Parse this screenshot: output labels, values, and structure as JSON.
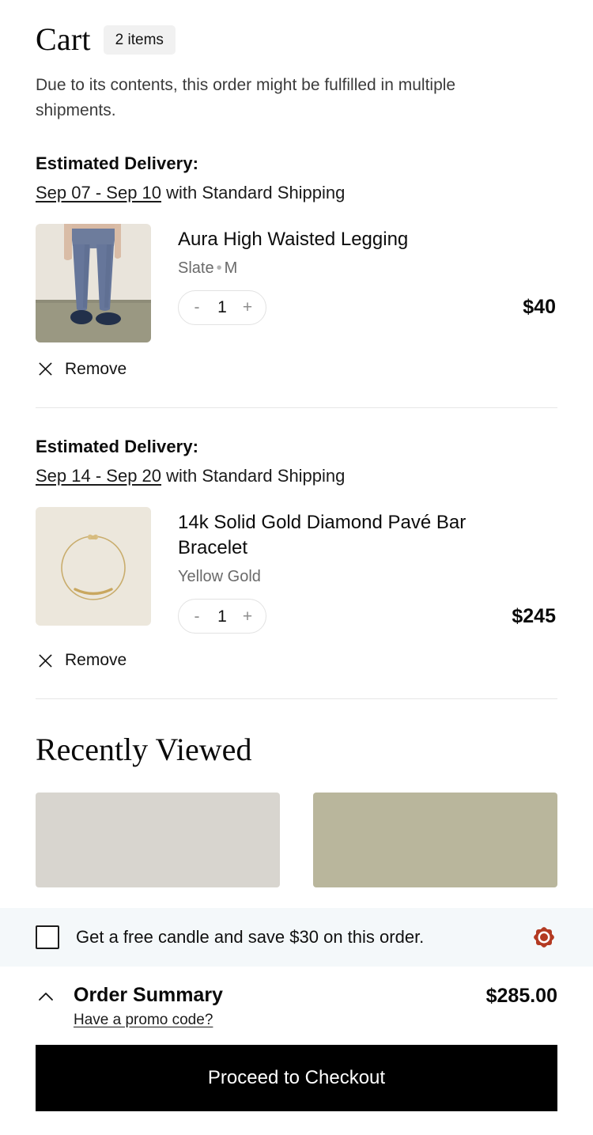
{
  "header": {
    "title": "Cart",
    "items_badge": "2 items",
    "fulfilment_note": "Due to its contents, this order might be fulfilled in multiple shipments."
  },
  "shipments": [
    {
      "delivery_label": "Estimated Delivery:",
      "delivery_dates": "Sep 07 - Sep 10",
      "delivery_method": " with Standard Shipping",
      "product": {
        "name": "Aura High Waisted Legging",
        "variant_color": "Slate",
        "variant_separator": "•",
        "variant_size": "M",
        "quantity": "1",
        "decrement_label": "-",
        "increment_label": "+",
        "price": "$40",
        "remove_label": "Remove",
        "image_alt": "slate-blue-leggings"
      }
    },
    {
      "delivery_label": "Estimated Delivery:",
      "delivery_dates": "Sep 14 - Sep 20",
      "delivery_method": " with Standard Shipping",
      "product": {
        "name": "14k Solid Gold Diamond Pavé Bar Bracelet",
        "variant_color": "Yellow Gold",
        "variant_separator": "",
        "variant_size": "",
        "quantity": "1",
        "decrement_label": "-",
        "increment_label": "+",
        "price": "$245",
        "remove_label": "Remove",
        "image_alt": "gold-bar-bracelet"
      }
    }
  ],
  "recently_viewed": {
    "title": "Recently Viewed",
    "cards": [
      {
        "swatch": "#d8d5cf"
      },
      {
        "swatch": "#b9b69c"
      }
    ]
  },
  "offer": {
    "text": "Get a free candle and save $30 on this order.",
    "checked": false,
    "badge_icon": "rosette-icon",
    "badge_color": "#b33a22"
  },
  "order_summary": {
    "toggle_icon": "chevron-up-icon",
    "title": "Order Summary",
    "total": "$285.00",
    "promo_link": "Have a promo code?"
  },
  "checkout": {
    "label": "Proceed to Checkout",
    "background": "#000000"
  }
}
